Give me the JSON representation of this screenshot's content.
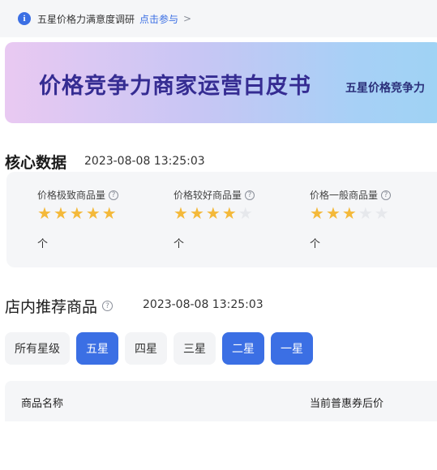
{
  "notice": {
    "text": "五星价格力满意度调研",
    "link": "点击参与",
    "arrow": ">"
  },
  "banner": {
    "title": "价格竞争力商家运营白皮书",
    "subtitle": "五星价格竞争力"
  },
  "core": {
    "title": "核心数据",
    "timestamp": "2023-08-08 13:25:03",
    "metrics": [
      {
        "label": "价格极致商品量",
        "stars": 5,
        "max_stars": 5,
        "unit": "个"
      },
      {
        "label": "价格较好商品量",
        "stars": 4,
        "max_stars": 5,
        "unit": "个"
      },
      {
        "label": "价格一般商品量",
        "stars": 3,
        "max_stars": 5,
        "unit": "个"
      }
    ]
  },
  "recommend": {
    "title": "店内推荐商品",
    "timestamp": "2023-08-08 13:25:03",
    "filters": [
      {
        "label": "所有星级",
        "active": false
      },
      {
        "label": "五星",
        "active": true
      },
      {
        "label": "四星",
        "active": false
      },
      {
        "label": "三星",
        "active": false
      },
      {
        "label": "二星",
        "active": true
      },
      {
        "label": "一星",
        "active": true
      }
    ]
  },
  "table": {
    "columns": [
      "商品名称",
      "当前普惠券后价"
    ]
  },
  "colors": {
    "accent": "#3b6fe4",
    "star_on": "#f4b93a",
    "star_off": "#e6e8ec",
    "banner_title": "#352c92"
  }
}
